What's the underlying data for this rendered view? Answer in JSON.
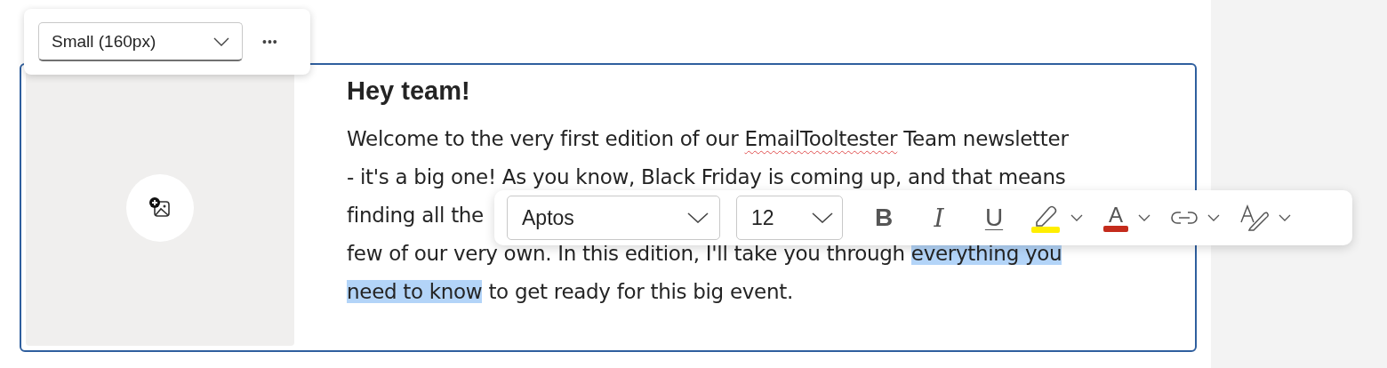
{
  "image_toolbar": {
    "size_select": "Small (160px)",
    "more_button": "•••"
  },
  "content": {
    "heading": "Hey team!",
    "lines": [
      [
        {
          "text": "Welcome to the very first edition of our ",
          "selected": false,
          "misspelled": false
        },
        {
          "text": "EmailTooltester",
          "selected": false,
          "misspelled": true
        },
        {
          "text": " Team newsletter",
          "selected": false,
          "misspelled": false
        }
      ],
      [
        {
          "text": "- it's a big one! As you know, Black Friday is coming up, and that means",
          "selected": false,
          "misspelled": false
        }
      ],
      [
        {
          "text": "finding all the",
          "selected": false,
          "misspelled": false
        }
      ],
      [
        {
          "text": "few of our very own. In this edition, I'll take you through ",
          "selected": false,
          "misspelled": false
        },
        {
          "text": "everything you",
          "selected": true,
          "misspelled": false
        }
      ],
      [
        {
          "text": "need to know",
          "selected": true,
          "misspelled": false
        },
        {
          "text": " to get ready for this big event.",
          "selected": false,
          "misspelled": false
        }
      ]
    ]
  },
  "format_toolbar": {
    "font": "Aptos",
    "size": "12",
    "buttons": [
      {
        "kind": "bold",
        "label": "B"
      },
      {
        "kind": "italic",
        "label": "I"
      },
      {
        "kind": "underline",
        "label": "U"
      },
      {
        "kind": "highlight",
        "color": "#ffee00"
      },
      {
        "kind": "font-color",
        "label": "A",
        "color": "#c42b1c"
      },
      {
        "kind": "link"
      },
      {
        "kind": "styles"
      }
    ]
  }
}
